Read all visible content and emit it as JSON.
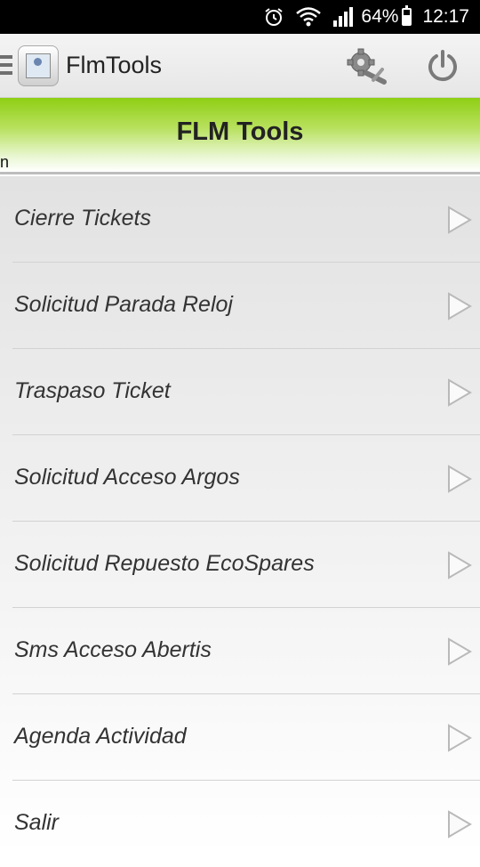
{
  "status_bar": {
    "battery_percent": "64%",
    "time": "12:17",
    "battery_level": 0.64,
    "icons": [
      "alarm-icon",
      "wifi-icon",
      "signal-icon",
      "battery-icon"
    ]
  },
  "action_bar": {
    "title": "FlmTools",
    "icons": [
      "drawer-icon",
      "app-icon",
      "settings-icon",
      "power-icon"
    ]
  },
  "banner": {
    "title": "FLM Tools",
    "subtitle": "n"
  },
  "menu": {
    "items": [
      {
        "label": "Cierre Tickets"
      },
      {
        "label": "Solicitud Parada Reloj"
      },
      {
        "label": "Traspaso Ticket"
      },
      {
        "label": "Solicitud Acceso Argos"
      },
      {
        "label": "Solicitud Repuesto EcoSpares"
      },
      {
        "label": "Sms Acceso Abertis"
      },
      {
        "label": "Agenda Actividad"
      },
      {
        "label": "Salir"
      }
    ]
  },
  "colors": {
    "banner_green": "#8fcf14",
    "status_bar": "#000000",
    "text": "#333333"
  }
}
